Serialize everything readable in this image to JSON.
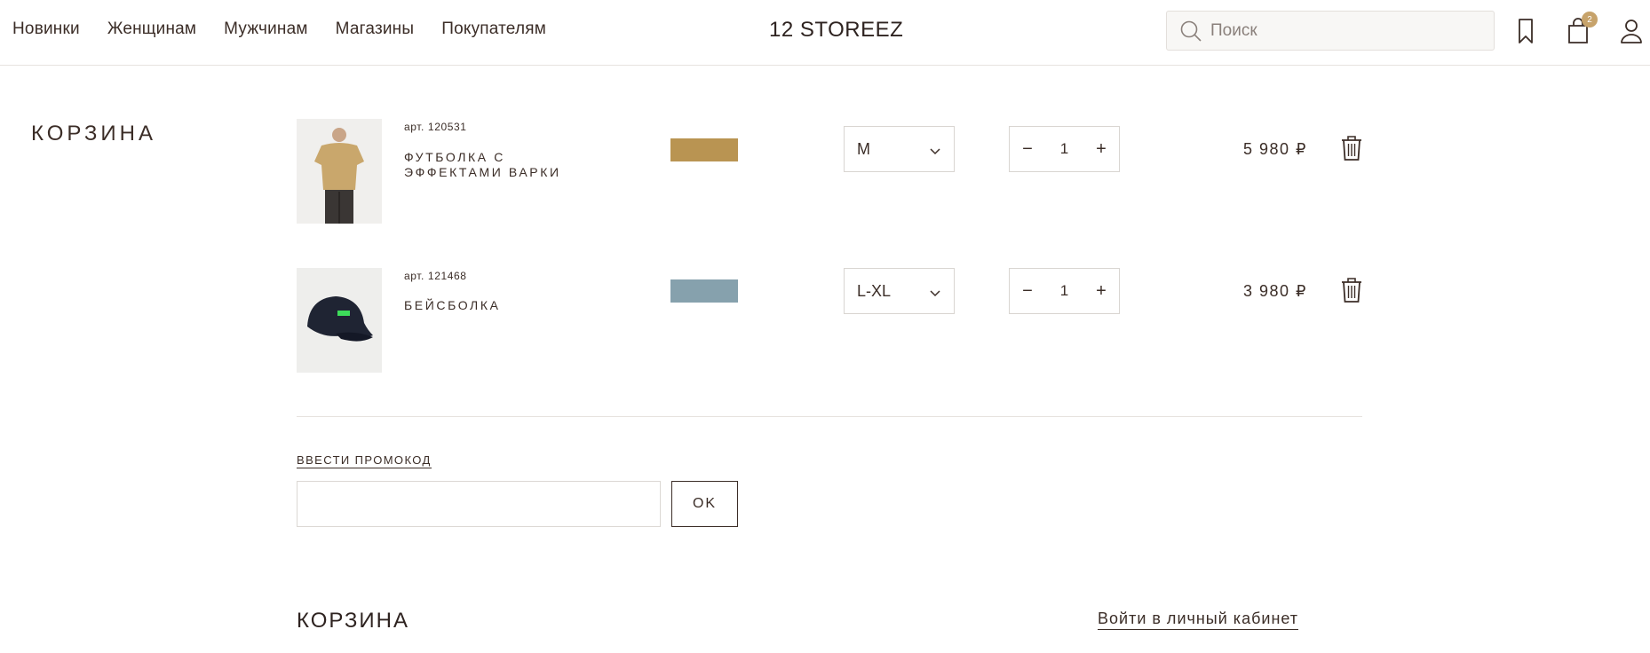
{
  "header": {
    "nav": [
      "Новинки",
      "Женщинам",
      "Мужчинам",
      "Магазины",
      "Покупателям"
    ],
    "logo": "12 STOREEZ",
    "search_placeholder": "Поиск",
    "cart_count": "2"
  },
  "cart": {
    "title": "КОРЗИНА",
    "items": [
      {
        "article": "арт. 120531",
        "name": "ФУТБОЛКА С ЭФФЕКТАМИ ВАРКИ",
        "color": "#b99452",
        "size": "M",
        "quantity": "1",
        "price": "5 980 ₽"
      },
      {
        "article": "арт. 121468",
        "name": "БЕЙСБОЛКА",
        "color": "#86a1ad",
        "size": "L-XL",
        "quantity": "1",
        "price": "3 980 ₽"
      }
    ],
    "promo_link": "ВВЕСТИ ПРОМОКОД",
    "promo_value": "",
    "ok_label": "OK",
    "bottom_title": "КОРЗИНА",
    "login_link": "Войти в личный кабинет"
  },
  "icons": {
    "search": "search-icon",
    "bookmark": "bookmark-icon",
    "bag": "shopping-bag-icon",
    "user": "user-icon",
    "trash": "trash-icon",
    "chevron": "chevron-down-icon"
  },
  "colors": {
    "text": "#3b2d27",
    "badge": "#c7a36b"
  }
}
